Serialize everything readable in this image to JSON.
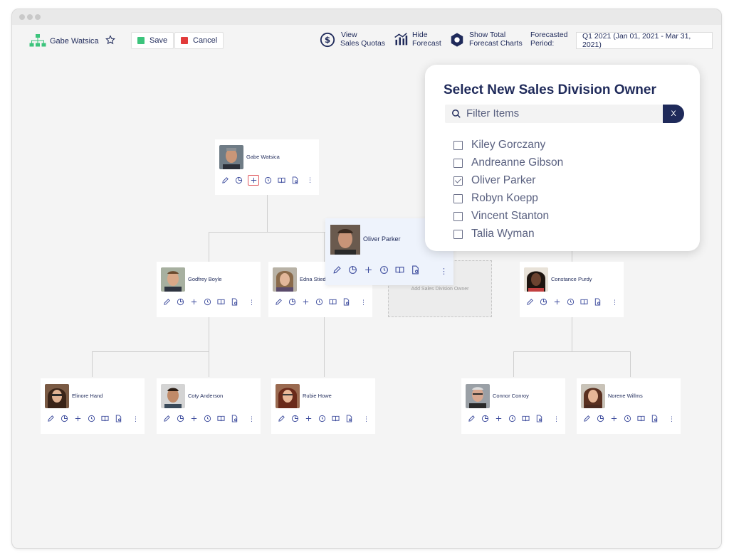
{
  "toolbar": {
    "user_name": "Gabe Watsica",
    "save_label": "Save",
    "cancel_label": "Cancel",
    "view_quotas_line1": "View",
    "view_quotas_line2": "Sales Quotas",
    "hide_forecast_line1": "Hide",
    "hide_forecast_line2": "Forecast",
    "show_charts_line1": "Show Total",
    "show_charts_line2": "Forecast Charts",
    "period_label_line1": "Forecasted",
    "period_label_line2": "Period:",
    "period_value": "Q1 2021 (Jan 01, 2021 - Mar 31, 2021)",
    "colors": {
      "save": "#3cc47c",
      "cancel": "#e23b3b",
      "accent": "#1f2a5a",
      "icon": "#3b4a9c"
    }
  },
  "org": {
    "root": {
      "name": "Gabe Watsica"
    },
    "level2": [
      {
        "name": "Godfrey Boyle"
      },
      {
        "name": "Edna Stiedemann"
      },
      {
        "name": "Constance Purdy"
      }
    ],
    "placeholder": "Add Sales Division Owner",
    "level3": [
      {
        "name": "Elinore Hand"
      },
      {
        "name": "Coty Anderson"
      },
      {
        "name": "Rubie Howe"
      },
      {
        "name": "Connor Conroy"
      },
      {
        "name": "Norene Willms"
      }
    ],
    "dragging": {
      "name": "Oliver Parker"
    },
    "card_icons": [
      "pencil-icon",
      "pie-chart-icon",
      "plus-icon",
      "clock-icon",
      "book-icon",
      "report-icon"
    ],
    "kebab": "⋮"
  },
  "modal": {
    "title": "Select New Sales Division Owner",
    "filter_placeholder": "Filter Items",
    "clear_label": "X",
    "options": [
      {
        "label": "Kiley Gorczany",
        "checked": false
      },
      {
        "label": "Andreanne Gibson",
        "checked": false
      },
      {
        "label": "Oliver Parker",
        "checked": true
      },
      {
        "label": "Robyn Koepp",
        "checked": false
      },
      {
        "label": "Vincent Stanton",
        "checked": false
      },
      {
        "label": "Talia Wyman",
        "checked": false
      }
    ]
  }
}
